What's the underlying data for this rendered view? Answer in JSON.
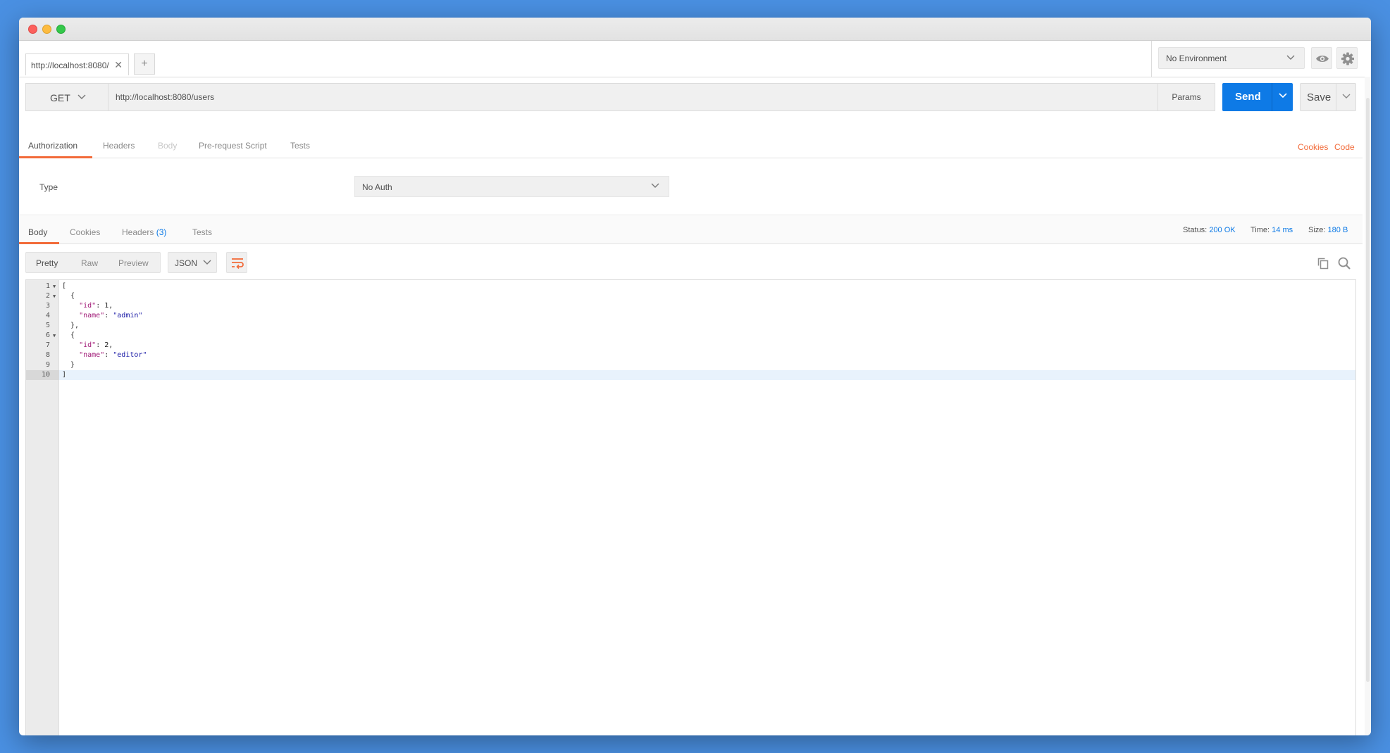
{
  "window": {
    "controls": [
      "close",
      "minimize",
      "maximize"
    ]
  },
  "tabs": {
    "active_tab": "http://localhost:8080/",
    "close_glyph": "✕",
    "add_glyph": "+"
  },
  "environment": {
    "selected": "No Environment",
    "icons": [
      "eye-icon",
      "gear-icon"
    ]
  },
  "request": {
    "method": "GET",
    "url": "http://localhost:8080/users",
    "params_label": "Params",
    "send_label": "Send",
    "save_label": "Save"
  },
  "request_tabs": [
    {
      "label": "Authorization",
      "active": true
    },
    {
      "label": "Headers",
      "active": false
    },
    {
      "label": "Body",
      "active": false,
      "disabled": true
    },
    {
      "label": "Pre-request Script",
      "active": false
    },
    {
      "label": "Tests",
      "active": false
    }
  ],
  "links": {
    "cookies": "Cookies",
    "code": "Code"
  },
  "authorization": {
    "type_label": "Type",
    "type_value": "No Auth"
  },
  "response_tabs": [
    {
      "label": "Body",
      "active": true
    },
    {
      "label": "Cookies",
      "active": false
    },
    {
      "label": "Headers",
      "count": "(3)",
      "active": false
    },
    {
      "label": "Tests",
      "active": false
    }
  ],
  "response_meta": {
    "status_label": "Status:",
    "status_value": "200 OK",
    "time_label": "Time:",
    "time_value": "14 ms",
    "size_label": "Size:",
    "size_value": "180 B"
  },
  "view": {
    "modes": [
      "Pretty",
      "Raw",
      "Preview"
    ],
    "active_mode": "Pretty",
    "format": "JSON"
  },
  "colors": {
    "accent": "#f26b3a",
    "send": "#0e7ae6",
    "json_key": "#a11b77",
    "json_string": "#1a1aa6"
  },
  "body_lines": [
    {
      "n": "1",
      "fold": true,
      "text": "["
    },
    {
      "n": "2",
      "fold": true,
      "text": "  {"
    },
    {
      "n": "3",
      "fold": false,
      "key": "\"id\"",
      "sep": ": ",
      "num": "1",
      "end": ","
    },
    {
      "n": "4",
      "fold": false,
      "key": "\"name\"",
      "sep": ": ",
      "str": "\"admin\"",
      "end": ""
    },
    {
      "n": "5",
      "fold": false,
      "text": "  },"
    },
    {
      "n": "6",
      "fold": true,
      "text": "  {"
    },
    {
      "n": "7",
      "fold": false,
      "key": "\"id\"",
      "sep": ": ",
      "num": "2",
      "end": ","
    },
    {
      "n": "8",
      "fold": false,
      "key": "\"name\"",
      "sep": ": ",
      "str": "\"editor\"",
      "end": ""
    },
    {
      "n": "9",
      "fold": false,
      "text": "  }"
    },
    {
      "n": "10",
      "fold": false,
      "text": "]",
      "current": true
    }
  ]
}
